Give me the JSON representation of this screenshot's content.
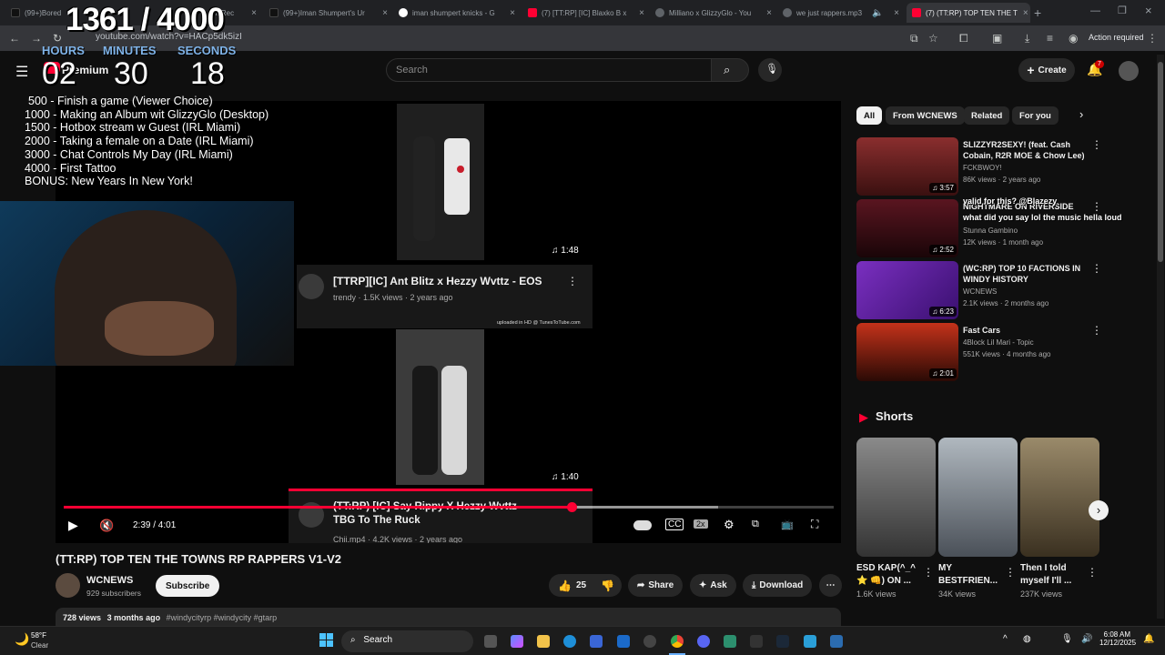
{
  "browser": {
    "tabs": [
      {
        "label": "(99+)Bored",
        "color": "#111111"
      },
      {
        "label": "n: Rec",
        "color": "#111111"
      },
      {
        "label": "(99+)Iman Shumpert's Ur",
        "color": "#111111"
      },
      {
        "label": "iman shumpert knicks - G",
        "color": "#4285f4"
      },
      {
        "label": "(7) [TT:RP] [IC] Blaxko B x",
        "color": "#ff0033"
      },
      {
        "label": "Milliano x GlizzyGlo - You",
        "color": "#5f6368"
      },
      {
        "label": "we just rappers.mp3",
        "color": "#5f6368"
      },
      {
        "label": "(7) (TT:RP) TOP TEN THE T",
        "color": "#ff0033"
      }
    ],
    "url": "youtube.com/watch?v=HACp5dk5izI",
    "action_required": "Action required"
  },
  "stream": {
    "goal_counter": "1361 / 4000",
    "timer": {
      "hours_label": "HOURS",
      "minutes_label": "MINUTES",
      "seconds_label": "SECONDS",
      "hours": "02",
      "minutes": "30",
      "seconds": "18"
    },
    "premium_label": "Premium",
    "goals": [
      "500 -  Finish a game (Viewer Choice)",
      "1000 - Making an Album wit GlizzyGlo (Desktop)",
      "1500 - Hotbox stream w Guest (IRL Miami)",
      "2000 - Taking a female on a Date (IRL Miami)",
      "3000 - Chat Controls My Day (IRL Miami)",
      "4000 - First Tattoo",
      "BONUS: New Years In New York!"
    ]
  },
  "youtube": {
    "search_placeholder": "Search",
    "create_label": "Create",
    "notifications_count": "7",
    "player": {
      "inner_videos": [
        {
          "title": "[TTRP][IC] Ant Blitz x Hezzy Wvttz - EOS",
          "channel": "trendy",
          "meta": "1.5K views · 2 years ago",
          "duration": "1:48",
          "badge": "uploaded in HD @ TunesToTube.com"
        },
        {
          "title": "(TT:RP) [IC] Say Rippy X Hezzy Wvttz TBG To The Ruck",
          "channel": "Chii.mp4",
          "meta": "4.2K views · 2 years ago",
          "duration": "1:40"
        }
      ],
      "time": "2:39 / 4:01",
      "progress": 0.66,
      "speed": "2x"
    },
    "video_title": "(TT:RP) TOP TEN THE TOWNS RP RAPPERS V1-V2",
    "channel_name": "WCNEWS",
    "subscribers": "929 subscribers",
    "subscribe_label": "Subscribe",
    "likes": "25",
    "share_label": "Share",
    "ask_label": "Ask",
    "download_label": "Download",
    "description": {
      "views": "728 views",
      "age": "3 months ago",
      "tags": "#windycityrp #windycity #gtarp"
    },
    "chips": [
      "All",
      "From WCNEWS",
      "Related",
      "For you"
    ],
    "recommendations": [
      {
        "title": "SLIZZYR2SEXY! (feat. Cash Cobain, R2R MOE & Chow Lee)",
        "channel": "FCKBWOY!",
        "meta": "86K views · 2 years ago",
        "duration": "3:57"
      },
      {
        "title": "NIGHTMARE ON RIVERSIDE",
        "channel": "Stunna Gambino",
        "meta": "12K views · 1 month ago",
        "duration": "2:52"
      },
      {
        "title": "(WC:RP) TOP 10 FACTIONS IN WINDY HISTORY",
        "channel": "WCNEWS",
        "meta": "2.1K views · 2 months ago",
        "duration": "6:23"
      },
      {
        "title": "Fast Cars",
        "channel": "4Block Lil Mari - Topic",
        "meta": "551K views · 4 months ago",
        "duration": "2:01"
      }
    ],
    "chat_overlay": [
      "valid for this? @Blazezy",
      "what did you say lol the music hella loud"
    ],
    "shorts_heading": "Shorts",
    "shorts": [
      {
        "title": "ESD KAP(^_^",
        "title2": "⭐ 👊) ON ...",
        "views": "1.6K views"
      },
      {
        "title": "MY",
        "title2": "BESTFRIEN...",
        "views": "34K views"
      },
      {
        "title": "Then I told",
        "title2": "myself I'll ...",
        "views": "237K views"
      }
    ]
  },
  "taskbar": {
    "weather_temp": "58°F",
    "weather_desc": "Clear",
    "search_label": "Search",
    "time": "6:08 AM",
    "date": "12/12/2025"
  }
}
